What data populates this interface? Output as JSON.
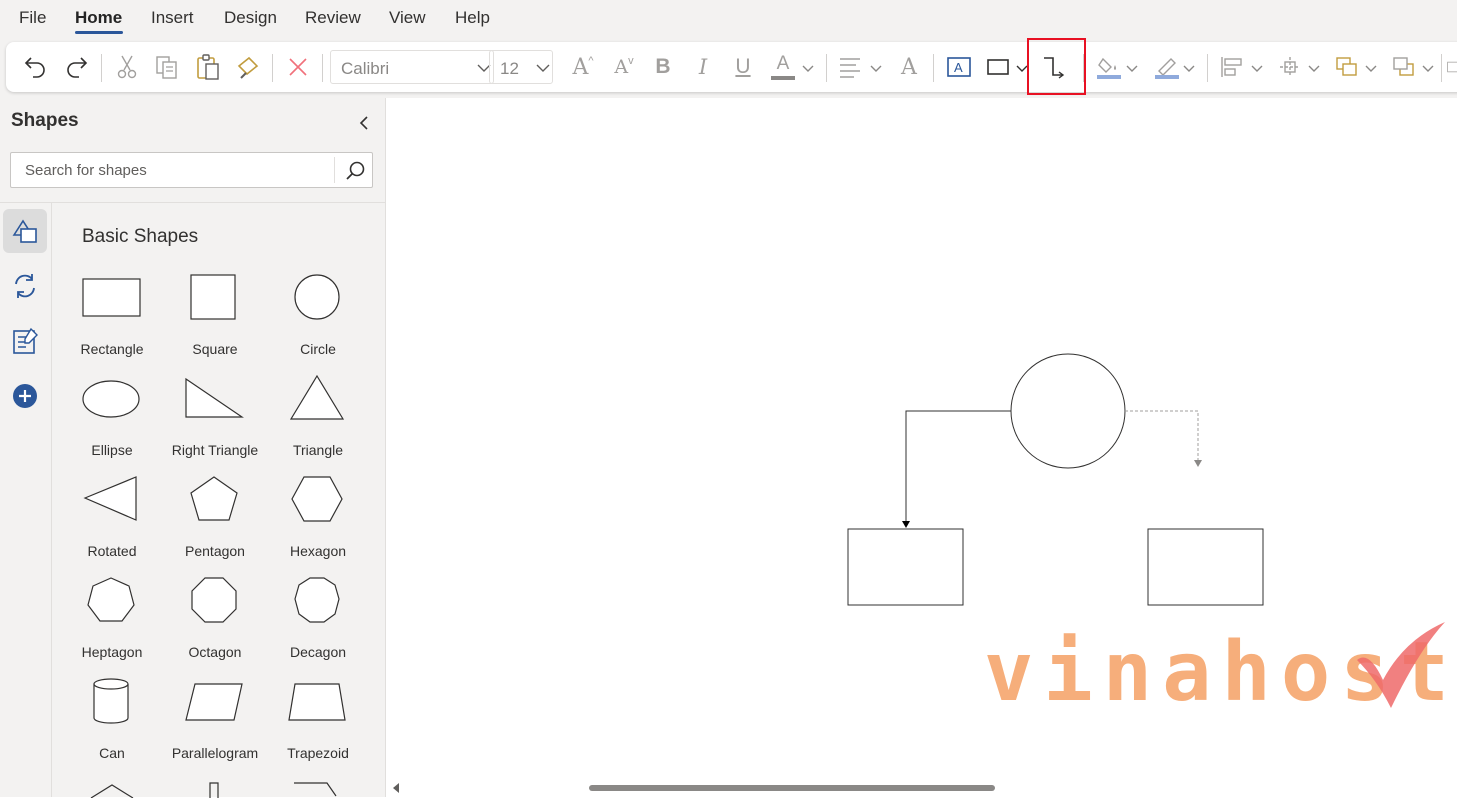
{
  "menu": {
    "items": [
      {
        "label": "File",
        "active": false
      },
      {
        "label": "Home",
        "active": true
      },
      {
        "label": "Insert",
        "active": false
      },
      {
        "label": "Design",
        "active": false
      },
      {
        "label": "Review",
        "active": false
      },
      {
        "label": "View",
        "active": false
      },
      {
        "label": "Help",
        "active": false
      }
    ]
  },
  "ribbon": {
    "font_name": "Calibri",
    "font_size": "12",
    "bold_glyph": "B",
    "italic_glyph": "I",
    "underline_glyph": "U",
    "font_color_glyph": "A",
    "grow_glyph": "A",
    "shrink_glyph": "A",
    "clear_glyph": "A",
    "highlighted_tool": "connector-icon",
    "highlight_color": "#e81123",
    "fill_accent": "#4472c4",
    "text_box_accent": "#2b579a"
  },
  "shapes_pane": {
    "title": "Shapes",
    "search_placeholder": "Search for shapes",
    "section_title": "Basic Shapes",
    "shapes": [
      {
        "label": "Rectangle",
        "icon": "rectangle-icon"
      },
      {
        "label": "Square",
        "icon": "square-icon"
      },
      {
        "label": "Circle",
        "icon": "circle-icon"
      },
      {
        "label": "Ellipse",
        "icon": "ellipse-icon"
      },
      {
        "label": "Right Triangle",
        "icon": "right-triangle-icon"
      },
      {
        "label": "Triangle",
        "icon": "triangle-icon"
      },
      {
        "label": "Rotated",
        "icon": "rotated-triangle-icon"
      },
      {
        "label": "Pentagon",
        "icon": "pentagon-icon"
      },
      {
        "label": "Hexagon",
        "icon": "hexagon-icon"
      },
      {
        "label": "Heptagon",
        "icon": "heptagon-icon"
      },
      {
        "label": "Octagon",
        "icon": "octagon-icon"
      },
      {
        "label": "Decagon",
        "icon": "decagon-icon"
      },
      {
        "label": "Can",
        "icon": "can-icon"
      },
      {
        "label": "Parallelogram",
        "icon": "parallelogram-icon"
      },
      {
        "label": "Trapezoid",
        "icon": "trapezoid-icon"
      }
    ],
    "rail": [
      "shapes-category-icon",
      "refresh-shapes-icon",
      "stencil-icon",
      "add-shapes-icon"
    ]
  },
  "watermark": {
    "text": "vinahost.",
    "text_color": "#f5a064",
    "mark_color": "#ef6a6a"
  }
}
